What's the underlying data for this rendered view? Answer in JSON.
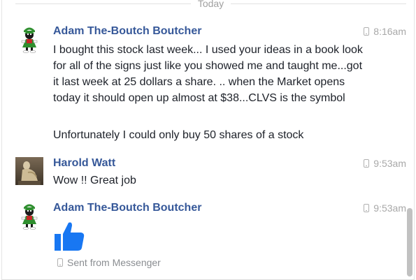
{
  "divider": {
    "label": "Today"
  },
  "messages": [
    {
      "sender": "Adam The-Boutch Boutcher",
      "time": "8:16am",
      "paragraphs": [
        "I bought this stock last week... I used your ideas in a book look for all of the signs just like you showed me and taught me...got it last week at 25 dollars a share. .. when the Market opens today it should open up almost at $38...CLVS is the symbol",
        "Unfortunately I could only buy 50 shares of a stock"
      ]
    },
    {
      "sender": "Harold Watt",
      "time": "9:53am",
      "paragraphs": [
        "Wow !! Great job"
      ]
    },
    {
      "sender": "Adam The-Boutch Boutcher",
      "time": "9:53am",
      "sticker": "thumbs-up-icon"
    }
  ],
  "sent_from": "Sent from Messenger",
  "colors": {
    "sender_name": "#365899",
    "like_blue": "#1877f2",
    "muted": "#a8a8a8"
  }
}
